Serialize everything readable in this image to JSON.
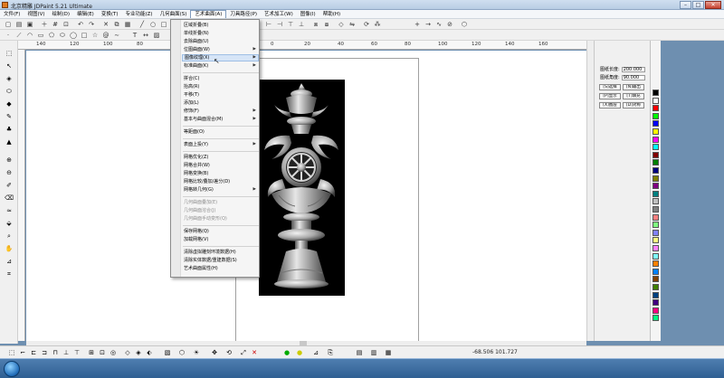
{
  "window": {
    "title": "北京精雕 JDPaint 5.21 Ultimate",
    "buttons": {
      "minimize": "–",
      "maximize": "□",
      "close": "✕"
    }
  },
  "menubar": {
    "items": [
      "文件(F)",
      "视图(V)",
      "绘制(D)",
      "编辑(E)",
      "变换(T)",
      "专业功能(Z)",
      "几何曲面(S)",
      "艺术曲面(A)",
      "刀具路径(P)",
      "艺术加工(W)",
      "图像(I)",
      "帮助(H)"
    ],
    "active_index": 7
  },
  "dropdown": {
    "items": [
      {
        "label": "区域折叠(B)",
        "disabled": false,
        "submenu": false
      },
      {
        "label": "单线折叠(N)",
        "disabled": false,
        "submenu": false
      },
      {
        "label": "去除曲面(U)",
        "disabled": false,
        "submenu": false
      },
      {
        "label": "位图曲面(W)",
        "disabled": false,
        "submenu": true
      },
      {
        "label": "图像纹理(X)",
        "disabled": false,
        "submenu": true,
        "hover": true
      },
      {
        "label": "标准曲面(K)",
        "disabled": false,
        "submenu": true
      },
      {
        "label": "拼合(C)",
        "disabled": false,
        "submenu": false
      },
      {
        "label": "抬高(R)",
        "disabled": false,
        "submenu": false
      },
      {
        "label": "平移(T)",
        "disabled": false,
        "submenu": false
      },
      {
        "label": "添加(L)",
        "disabled": false,
        "submenu": false
      },
      {
        "label": "修饰(F)",
        "disabled": false,
        "submenu": true
      },
      {
        "label": "基本与曲面混合(M)",
        "disabled": false,
        "submenu": true
      },
      {
        "label": "等距面(O)",
        "disabled": false,
        "submenu": false
      },
      {
        "label": "表面上投(Y)",
        "disabled": false,
        "submenu": true
      },
      {
        "label": "网格优化(Z)",
        "disabled": false,
        "submenu": false
      },
      {
        "label": "网格合并(W)",
        "disabled": false,
        "submenu": false
      },
      {
        "label": "网格变换(B)",
        "disabled": false,
        "submenu": false
      },
      {
        "label": "网格比较/叠加/差分(D)",
        "disabled": false,
        "submenu": false
      },
      {
        "label": "网格转几何(G)",
        "disabled": false,
        "submenu": true
      },
      {
        "label": "几何曲面叠加(E)",
        "disabled": true,
        "submenu": false
      },
      {
        "label": "几何曲面溶合(J)",
        "disabled": true,
        "submenu": false
      },
      {
        "label": "几何曲面手动变形(Q)",
        "disabled": true,
        "submenu": false
      },
      {
        "label": "保存网格(Q)",
        "disabled": false,
        "submenu": false
      },
      {
        "label": "加载网格(V)",
        "disabled": false,
        "submenu": false
      },
      {
        "label": "清除虚拟雕刻环境数据(H)",
        "disabled": false,
        "submenu": false
      },
      {
        "label": "清除实体数据/重建数据(S)",
        "disabled": false,
        "submenu": false
      },
      {
        "label": "艺术曲面属性(H)",
        "disabled": false,
        "submenu": false
      }
    ]
  },
  "ruler": {
    "labels": [
      "140",
      "120",
      "100",
      "80",
      "60",
      "40",
      "20",
      "0",
      "20",
      "40",
      "60",
      "80",
      "100",
      "120",
      "140",
      "160"
    ]
  },
  "right_panel": {
    "fields": [
      {
        "label": "图纸长度:",
        "value": "200.000"
      },
      {
        "label": "图纸角度:",
        "value": "90.000"
      }
    ],
    "buttons": [
      [
        "[S]选择",
        "[N]输出"
      ],
      [
        "[P]显示",
        "[T]填充"
      ],
      [
        "[X]图层",
        "[D]对称"
      ]
    ]
  },
  "palette": {
    "colors": [
      "#000000",
      "#ffffff",
      "#ff0000",
      "#00ff00",
      "#0000ff",
      "#ffff00",
      "#ff00ff",
      "#00ffff",
      "#800000",
      "#008000",
      "#000080",
      "#808000",
      "#800080",
      "#008080",
      "#c0c0c0",
      "#808080",
      "#ff8080",
      "#80ff80",
      "#8080ff",
      "#ffff80",
      "#ff80ff",
      "#80ffff",
      "#ff8000",
      "#0080ff",
      "#804000",
      "#408000",
      "#004080",
      "#400080",
      "#ff0080",
      "#00ff80"
    ]
  },
  "status": {
    "coordinates": "-68.506  101.727"
  }
}
